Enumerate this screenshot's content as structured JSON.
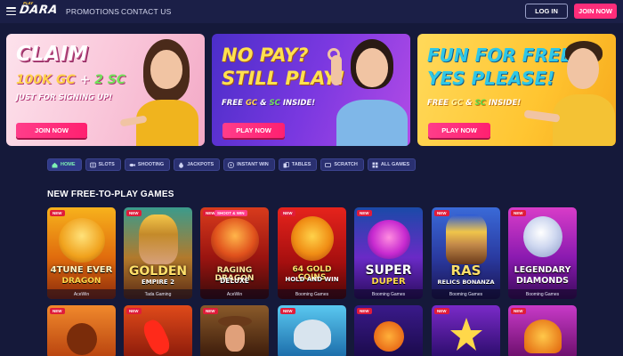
{
  "header": {
    "logo_tag": "PLAY",
    "logo": "DARA",
    "nav": [
      "PROMOTIONS",
      "CONTACT US"
    ],
    "login_label": "LOG IN",
    "join_label": "JOIN NOW"
  },
  "banners": [
    {
      "line1": "CLAIM",
      "line2_gold": "100K GC",
      "line2_plus": " + ",
      "line2_green": "2 SC",
      "sub": "JUST FOR SIGNING UP!",
      "button": "JOIN NOW"
    },
    {
      "line1": "NO PAY?",
      "line2": "STILL PLAY!",
      "sub_a": "FREE ",
      "sub_gold": "GC",
      "sub_b": " & ",
      "sub_green": "SC",
      "sub_c": " INSIDE!",
      "button": "PLAY NOW"
    },
    {
      "line1": "FUN FOR FREE?",
      "line2": "YES PLEASE!",
      "sub_a": "FREE ",
      "sub_gold": "GC",
      "sub_b": " & ",
      "sub_green": "SC",
      "sub_c": " INSIDE!",
      "button": "PLAY NOW"
    }
  ],
  "tabs": [
    {
      "label": "HOME",
      "icon": "home-icon"
    },
    {
      "label": "SLOTS",
      "icon": "slots-icon"
    },
    {
      "label": "SHOOTING",
      "icon": "fish-icon"
    },
    {
      "label": "JACKPOTS",
      "icon": "money-bag-icon"
    },
    {
      "label": "INSTANT WIN",
      "icon": "lightning-icon"
    },
    {
      "label": "TABLES",
      "icon": "cards-icon"
    },
    {
      "label": "SCRATCH",
      "icon": "ticket-icon"
    },
    {
      "label": "ALL GAMES",
      "icon": "grid-icon"
    }
  ],
  "section_title": "NEW FREE-TO-PLAY GAMES",
  "games": [
    {
      "badge": "NEW",
      "title1": "4TUNE EVER",
      "title2": "DRAGON",
      "provider": "AceWin"
    },
    {
      "badge": "NEW",
      "title1": "GOLDEN",
      "title2": "EMPIRE 2",
      "provider": "Tada Gaming"
    },
    {
      "badge": "NEW",
      "extra": "SHOOT & WIN",
      "title1": "RAGING DRAGON",
      "title2": "DELUXE",
      "provider": "AceWin"
    },
    {
      "badge": "NEW",
      "title1": "64 GOLD COINS",
      "title2": "HOLD AND WIN",
      "provider": "Booming Games"
    },
    {
      "badge": "NEW",
      "title1": "SUPER",
      "title2": "DUPER",
      "provider": "Booming Games"
    },
    {
      "badge": "NEW",
      "title1": "RAS",
      "title2": "RELICS BONANZA",
      "provider": "Booming Games"
    },
    {
      "badge": "NEW",
      "title1": "LEGENDARY",
      "title2": "DIAMONDS",
      "provider": "Booming Games"
    }
  ],
  "row2_badges": [
    "NEW",
    "NEW",
    "NEW",
    "NEW",
    "NEW",
    "NEW",
    "NEW"
  ],
  "colors": {
    "background": "#15193a",
    "header": "#1b1f47",
    "accent_pink": "#ff2d7a",
    "tab_active": "#7df0b3"
  }
}
